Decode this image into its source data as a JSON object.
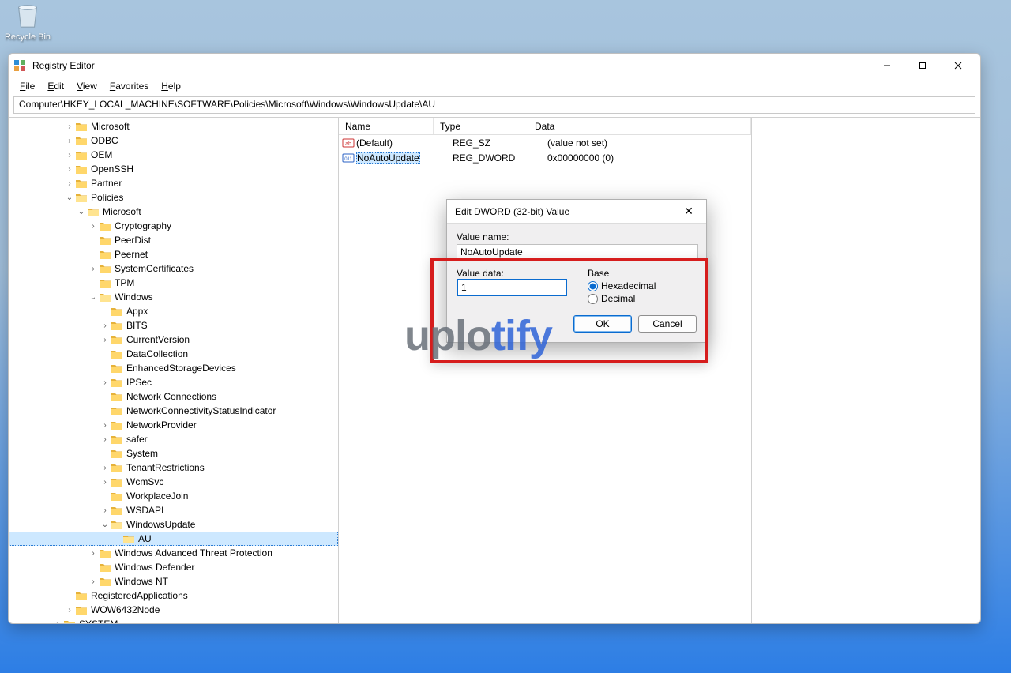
{
  "desktop": {
    "recycle_bin": "Recycle Bin"
  },
  "window": {
    "title": "Registry Editor",
    "menu": {
      "file": "File",
      "edit": "Edit",
      "view": "View",
      "favorites": "Favorites",
      "help": "Help"
    },
    "address": "Computer\\HKEY_LOCAL_MACHINE\\SOFTWARE\\Policies\\Microsoft\\Windows\\WindowsUpdate\\AU"
  },
  "tree": {
    "microsoft": "Microsoft",
    "odbc": "ODBC",
    "oem": "OEM",
    "openssh": "OpenSSH",
    "partner": "Partner",
    "policies": "Policies",
    "pol_microsoft": "Microsoft",
    "cryptography": "Cryptography",
    "peerdist": "PeerDist",
    "peernet": "Peernet",
    "systemcertificates": "SystemCertificates",
    "tpm": "TPM",
    "windows": "Windows",
    "appx": "Appx",
    "bits": "BITS",
    "currentversion": "CurrentVersion",
    "datacollection": "DataCollection",
    "esd": "EnhancedStorageDevices",
    "ipsec": "IPSec",
    "netconn": "Network Connections",
    "ncsi": "NetworkConnectivityStatusIndicator",
    "netprov": "NetworkProvider",
    "safer": "safer",
    "system": "System",
    "tenant": "TenantRestrictions",
    "wcmsvc": "WcmSvc",
    "workplace": "WorkplaceJoin",
    "wsdapi": "WSDAPI",
    "windowsupdate": "WindowsUpdate",
    "au": "AU",
    "watp": "Windows Advanced Threat Protection",
    "defender": "Windows Defender",
    "winnt": "Windows NT",
    "regapps": "RegisteredApplications",
    "wow64": "WOW6432Node",
    "system_root": "SYSTEM"
  },
  "list": {
    "header": {
      "name": "Name",
      "type": "Type",
      "data": "Data"
    },
    "rows": [
      {
        "name": "(Default)",
        "type": "REG_SZ",
        "data": "(value not set)",
        "icon": "string"
      },
      {
        "name": "NoAutoUpdate",
        "type": "REG_DWORD",
        "data": "0x00000000 (0)",
        "icon": "dword"
      }
    ]
  },
  "dialog": {
    "title": "Edit DWORD (32-bit) Value",
    "value_name_label": "Value name:",
    "value_name": "NoAutoUpdate",
    "value_data_label": "Value data:",
    "value_data": "1",
    "base_label": "Base",
    "hex": "Hexadecimal",
    "dec": "Decimal",
    "ok": "OK",
    "cancel": "Cancel"
  },
  "watermark_a": "uplo",
  "watermark_b": "tify"
}
